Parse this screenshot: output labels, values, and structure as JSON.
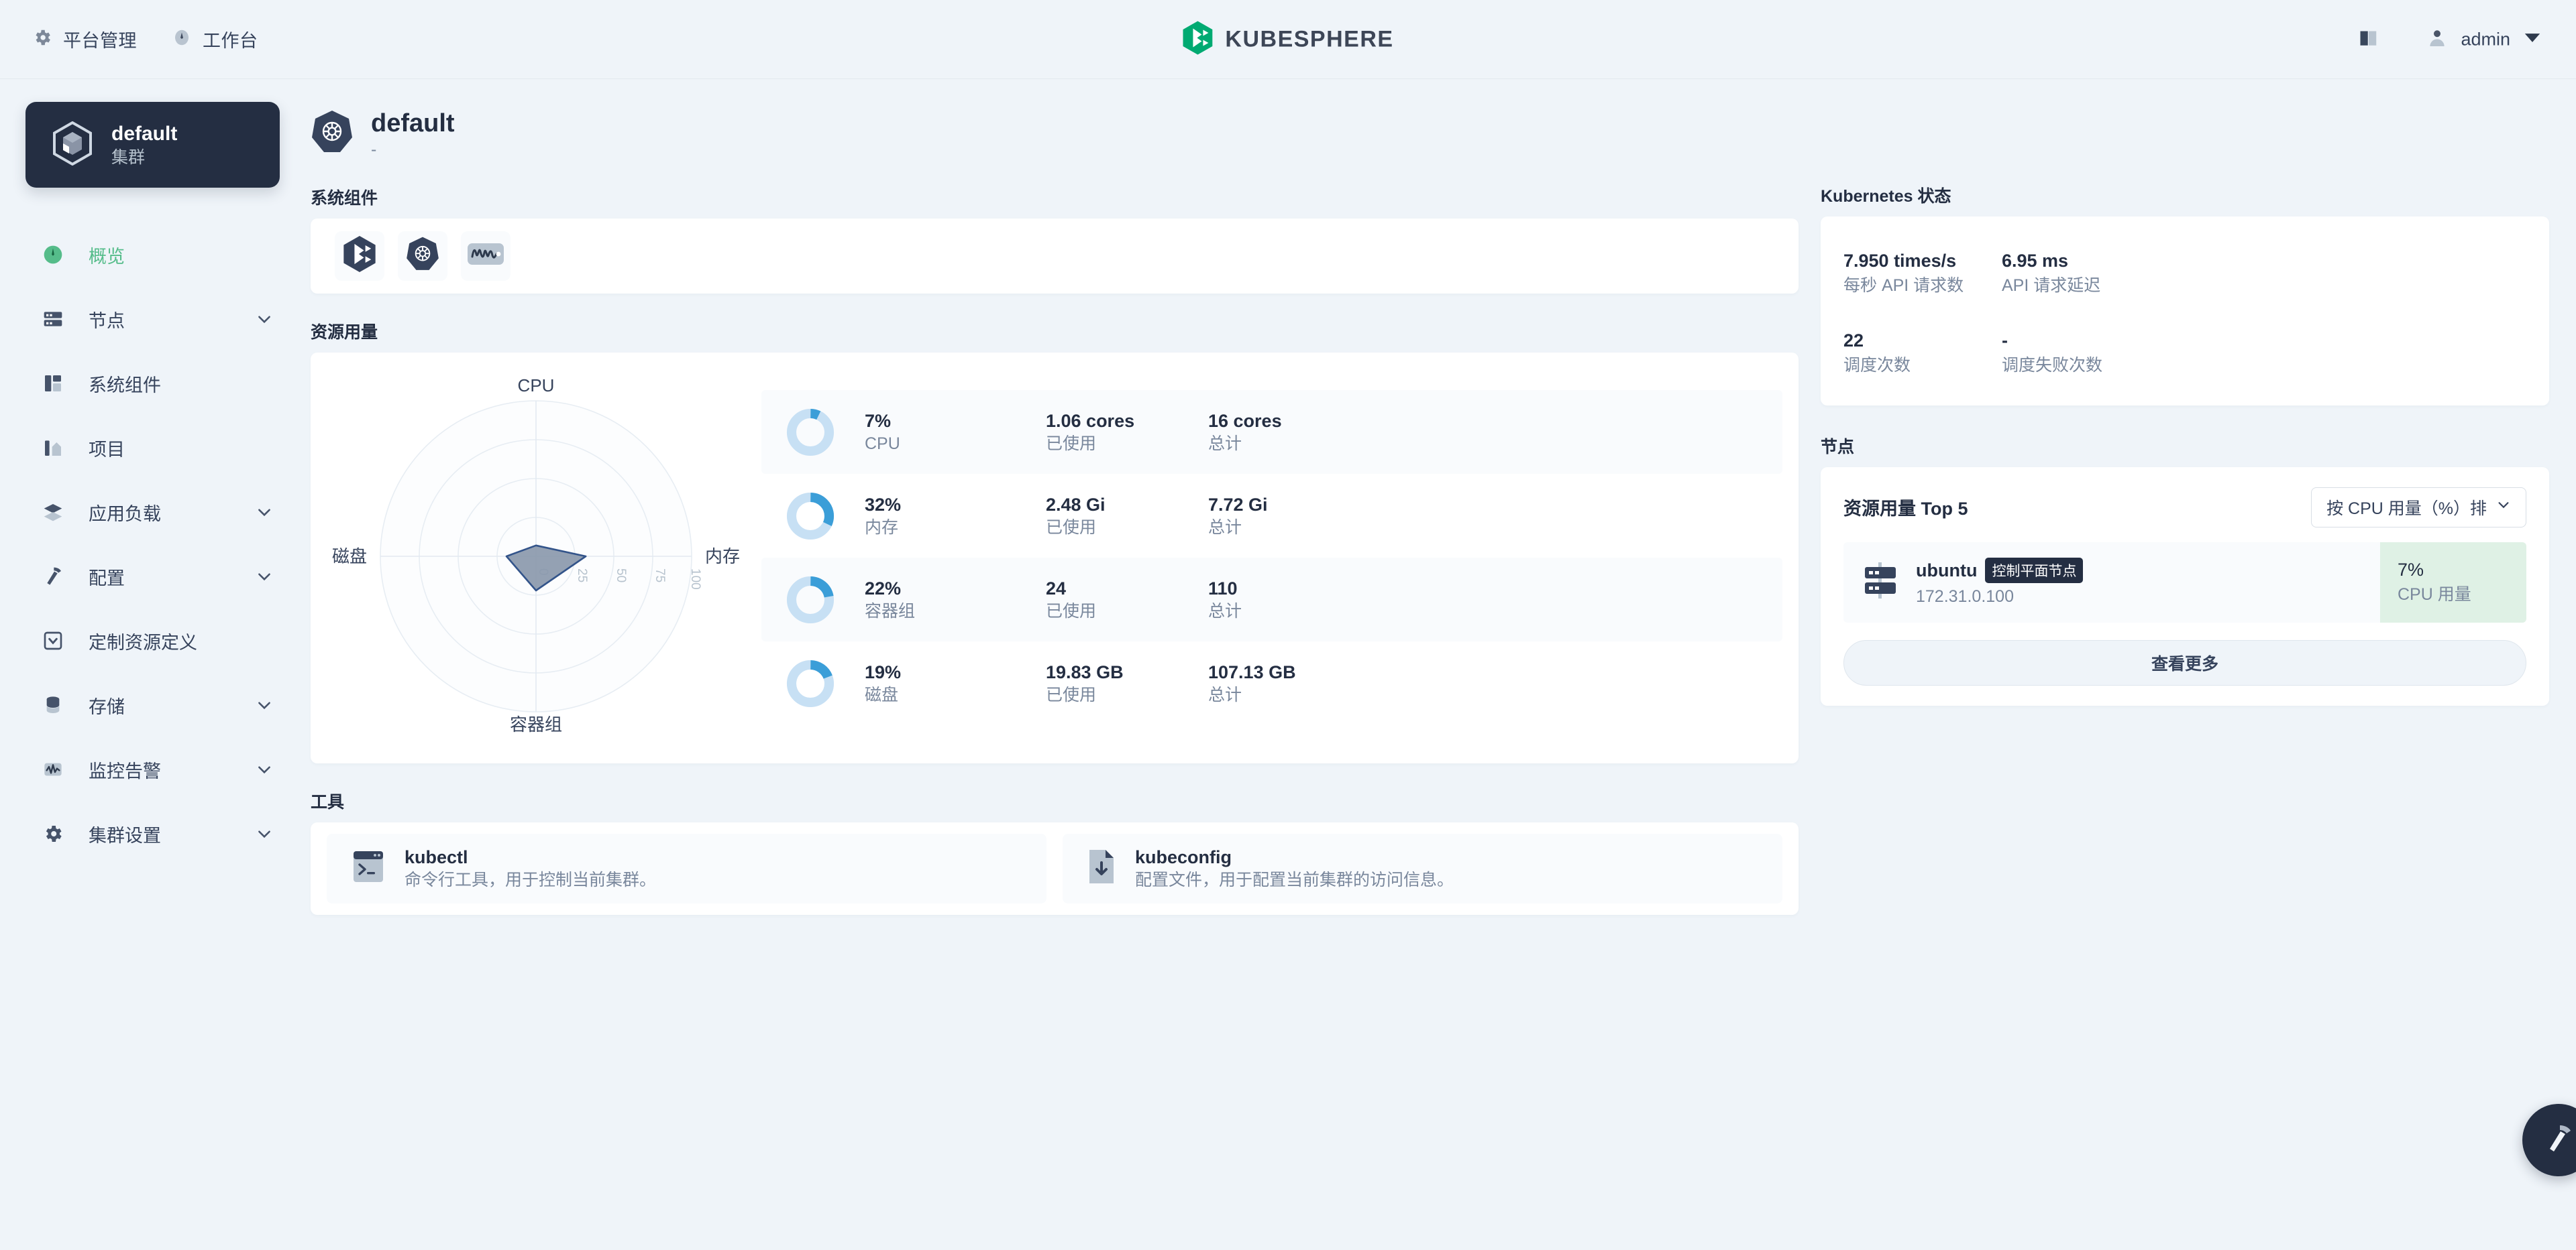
{
  "topbar": {
    "nav": [
      {
        "label": "平台管理",
        "icon": "gear-icon"
      },
      {
        "label": "工作台",
        "icon": "compass-icon"
      }
    ],
    "brand": "KUBESPHERE",
    "docs_icon": "book-icon",
    "user": "admin",
    "user_icon": "user-avatar-icon",
    "caret_icon": "chevron-down-icon"
  },
  "sidebar": {
    "cluster": {
      "name": "default",
      "type": "集群",
      "icon": "cube-icon"
    },
    "items": [
      {
        "label": "概览",
        "icon": "dashboard-icon",
        "active": true,
        "expandable": false
      },
      {
        "label": "节点",
        "icon": "server-icon",
        "active": false,
        "expandable": true
      },
      {
        "label": "系统组件",
        "icon": "components-icon",
        "active": false,
        "expandable": false
      },
      {
        "label": "项目",
        "icon": "project-icon",
        "active": false,
        "expandable": false
      },
      {
        "label": "应用负载",
        "icon": "layers-icon",
        "active": false,
        "expandable": true
      },
      {
        "label": "配置",
        "icon": "hammer-icon",
        "active": false,
        "expandable": true
      },
      {
        "label": "定制资源定义",
        "icon": "crd-icon",
        "active": false,
        "expandable": false
      },
      {
        "label": "存储",
        "icon": "database-icon",
        "active": false,
        "expandable": true
      },
      {
        "label": "监控告警",
        "icon": "monitor-icon",
        "active": false,
        "expandable": true
      },
      {
        "label": "集群设置",
        "icon": "gear-icon",
        "active": false,
        "expandable": true
      }
    ]
  },
  "page": {
    "title": "default",
    "subtitle": "-",
    "icon": "kubernetes-icon"
  },
  "system_components": {
    "title": "系统组件",
    "items": [
      {
        "name": "kubesphere-component",
        "icon": "kubesphere-logo-icon"
      },
      {
        "name": "kubernetes-component",
        "icon": "kubernetes-icon"
      },
      {
        "name": "monitoring-component",
        "icon": "waveform-icon"
      }
    ]
  },
  "resource_usage": {
    "title": "资源用量",
    "used_label": "已使用",
    "total_label": "总计",
    "rows": [
      {
        "percent": "7%",
        "name": "CPU",
        "used": "1.06 cores",
        "total": "16 cores",
        "value": 7
      },
      {
        "percent": "32%",
        "name": "内存",
        "used": "2.48 Gi",
        "total": "7.72 Gi",
        "value": 32
      },
      {
        "percent": "22%",
        "name": "容器组",
        "used": "24",
        "total": "110",
        "value": 22
      },
      {
        "percent": "19%",
        "name": "磁盘",
        "used": "19.83 GB",
        "total": "107.13 GB",
        "value": 19
      }
    ],
    "colors": {
      "track": "#c7e0f4",
      "fill": "#3b9ed8"
    }
  },
  "chart_data": {
    "type": "radar",
    "title": "资源用量",
    "categories": [
      "CPU",
      "内存",
      "容器组",
      "磁盘"
    ],
    "values": [
      7,
      32,
      22,
      19
    ],
    "axis_ticks": [
      0,
      25,
      50,
      75,
      100
    ],
    "rlim": [
      0,
      100
    ],
    "tick_axis": "内存",
    "grid": true,
    "grid_shape": "circle",
    "rings": 4,
    "area_fill": "#8b99ad",
    "area_stroke": "#33548a",
    "legend": "none"
  },
  "tools": {
    "title": "工具",
    "items": [
      {
        "name": "kubectl",
        "desc": "命令行工具，用于控制当前集群。",
        "icon": "terminal-icon"
      },
      {
        "name": "kubeconfig",
        "desc": "配置文件，用于配置当前集群的访问信息。",
        "icon": "file-download-icon"
      }
    ]
  },
  "k8s_status": {
    "title": "Kubernetes 状态",
    "stats": [
      {
        "value": "7.950 times/s",
        "label": "每秒 API 请求数"
      },
      {
        "value": "6.95 ms",
        "label": "API 请求延迟"
      },
      {
        "value": "22",
        "label": "调度次数"
      },
      {
        "value": "-",
        "label": "调度失败次数"
      }
    ]
  },
  "nodes": {
    "title": "节点",
    "subtitle": "资源用量 Top 5",
    "sort_label": "按 CPU 用量（%）排",
    "sort_caret": "chevron-down-icon",
    "rows": [
      {
        "name": "ubuntu",
        "badge": "控制平面节点",
        "ip": "172.31.0.100",
        "metric_value": "7%",
        "metric_label": "CPU 用量",
        "icon": "server-icon"
      }
    ],
    "view_more": "查看更多"
  },
  "fab": {
    "icon": "hammer-icon"
  },
  "colors": {
    "accent_green": "#55bc8a",
    "brand_green": "#00aa72",
    "dark": "#242e42",
    "bg": "#eff4f9",
    "metric_green_bg": "#dff1e5"
  }
}
